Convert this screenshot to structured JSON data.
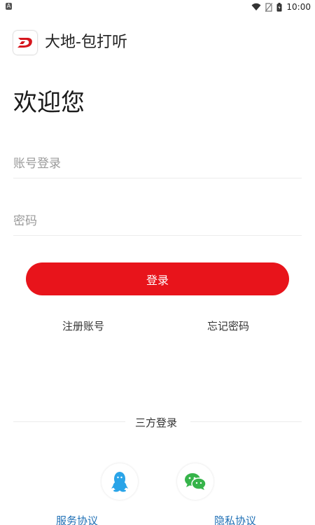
{
  "status_bar": {
    "time": "10:00",
    "left_icon": "notification-a-icon",
    "icons": [
      "wifi-icon",
      "no-sim-icon",
      "battery-icon"
    ]
  },
  "app": {
    "title": "大地-包打听",
    "logo_icon": "dadi-logo-icon",
    "logo_letter": "D",
    "brand_color": "#e8141b"
  },
  "main": {
    "welcome": "欢迎您",
    "account_placeholder": "账号登录",
    "account_value": "",
    "password_placeholder": "密码",
    "password_value": "",
    "login_label": "登录",
    "register_label": "注册账号",
    "forgot_label": "忘记密码"
  },
  "third_party": {
    "label": "三方登录",
    "providers": [
      {
        "name": "qq",
        "icon": "qq-icon",
        "color": "#2aa4e8"
      },
      {
        "name": "wechat",
        "icon": "wechat-icon",
        "color": "#36b44a"
      }
    ]
  },
  "footer": {
    "service_label": "服务协议",
    "privacy_label": "隐私协议",
    "link_color": "#1e6fb5"
  }
}
